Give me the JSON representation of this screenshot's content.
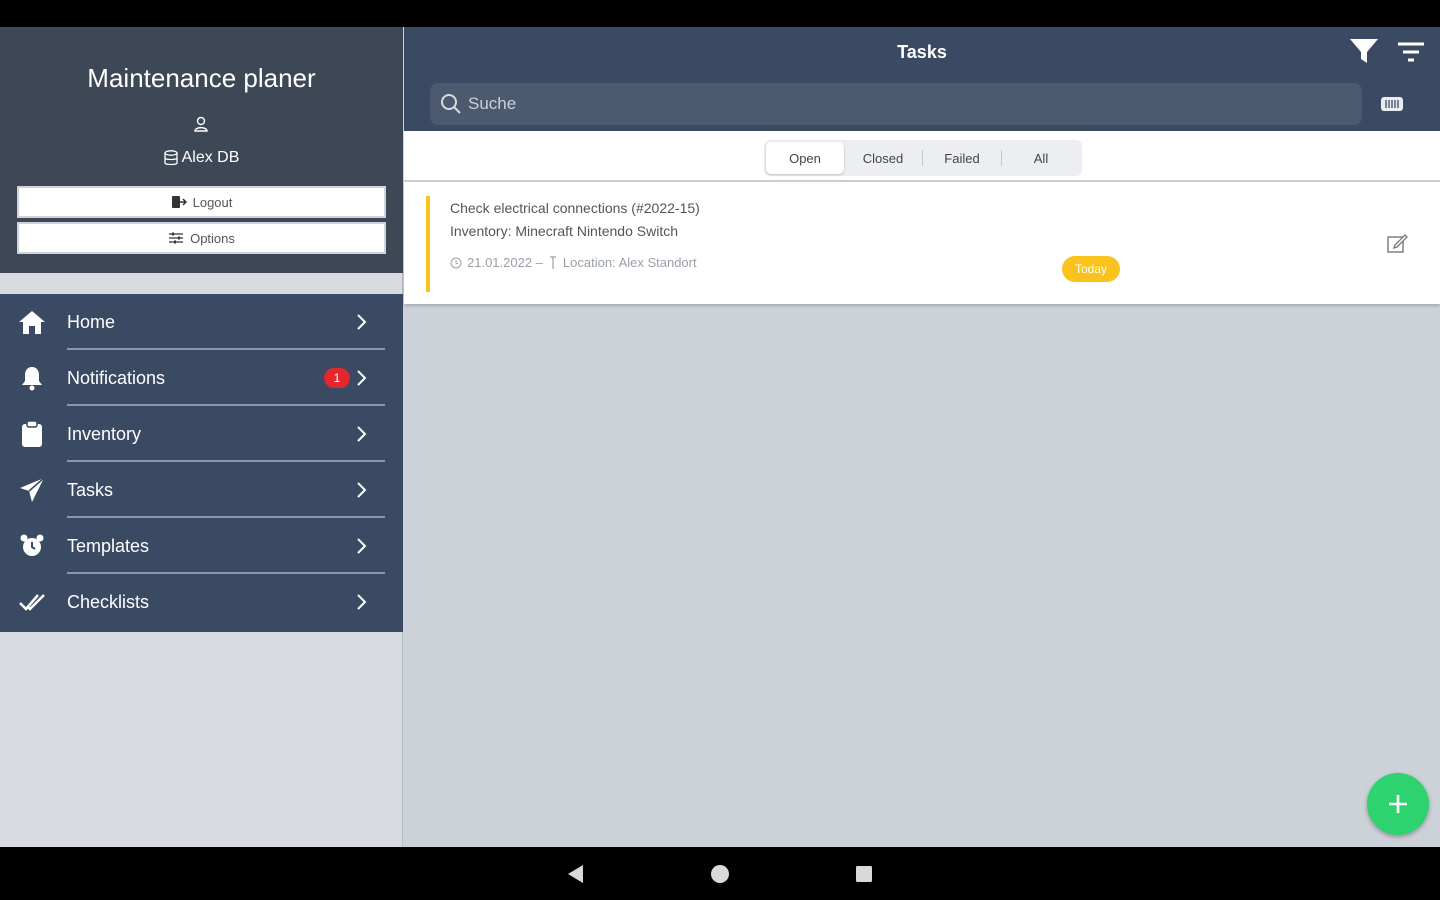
{
  "sidebar": {
    "app_title": "Maintenance planer",
    "user_name": "Alex DB",
    "logout_label": "Logout",
    "options_label": "Options",
    "nav_items": [
      {
        "label": "Home",
        "icon": "home-icon"
      },
      {
        "label": "Notifications",
        "icon": "bell-icon",
        "badge": "1"
      },
      {
        "label": "Inventory",
        "icon": "clipboard-icon"
      },
      {
        "label": "Tasks",
        "icon": "paper-plane-icon"
      },
      {
        "label": "Templates",
        "icon": "alarm-clock-icon"
      },
      {
        "label": "Checklists",
        "icon": "checkmarks-icon"
      }
    ]
  },
  "header": {
    "title": "Tasks",
    "search_placeholder": "Suche"
  },
  "segments": {
    "items": [
      "Open",
      "Closed",
      "Failed",
      "All"
    ],
    "selected": "Open"
  },
  "tasks": [
    {
      "title": "Check electrical connections (#2022-15)",
      "inventory": "Inventory: Minecraft Nintendo Switch",
      "date": "21.01.2022 –",
      "location": "Location: Alex Standort",
      "due_chip": "Today"
    }
  ],
  "colors": {
    "header_bg": "#3a4a62",
    "profile_bg": "#3e4755",
    "accent_yellow": "#f8c31e",
    "badge_red": "#e5262f",
    "fab_green": "#2dd36f"
  }
}
